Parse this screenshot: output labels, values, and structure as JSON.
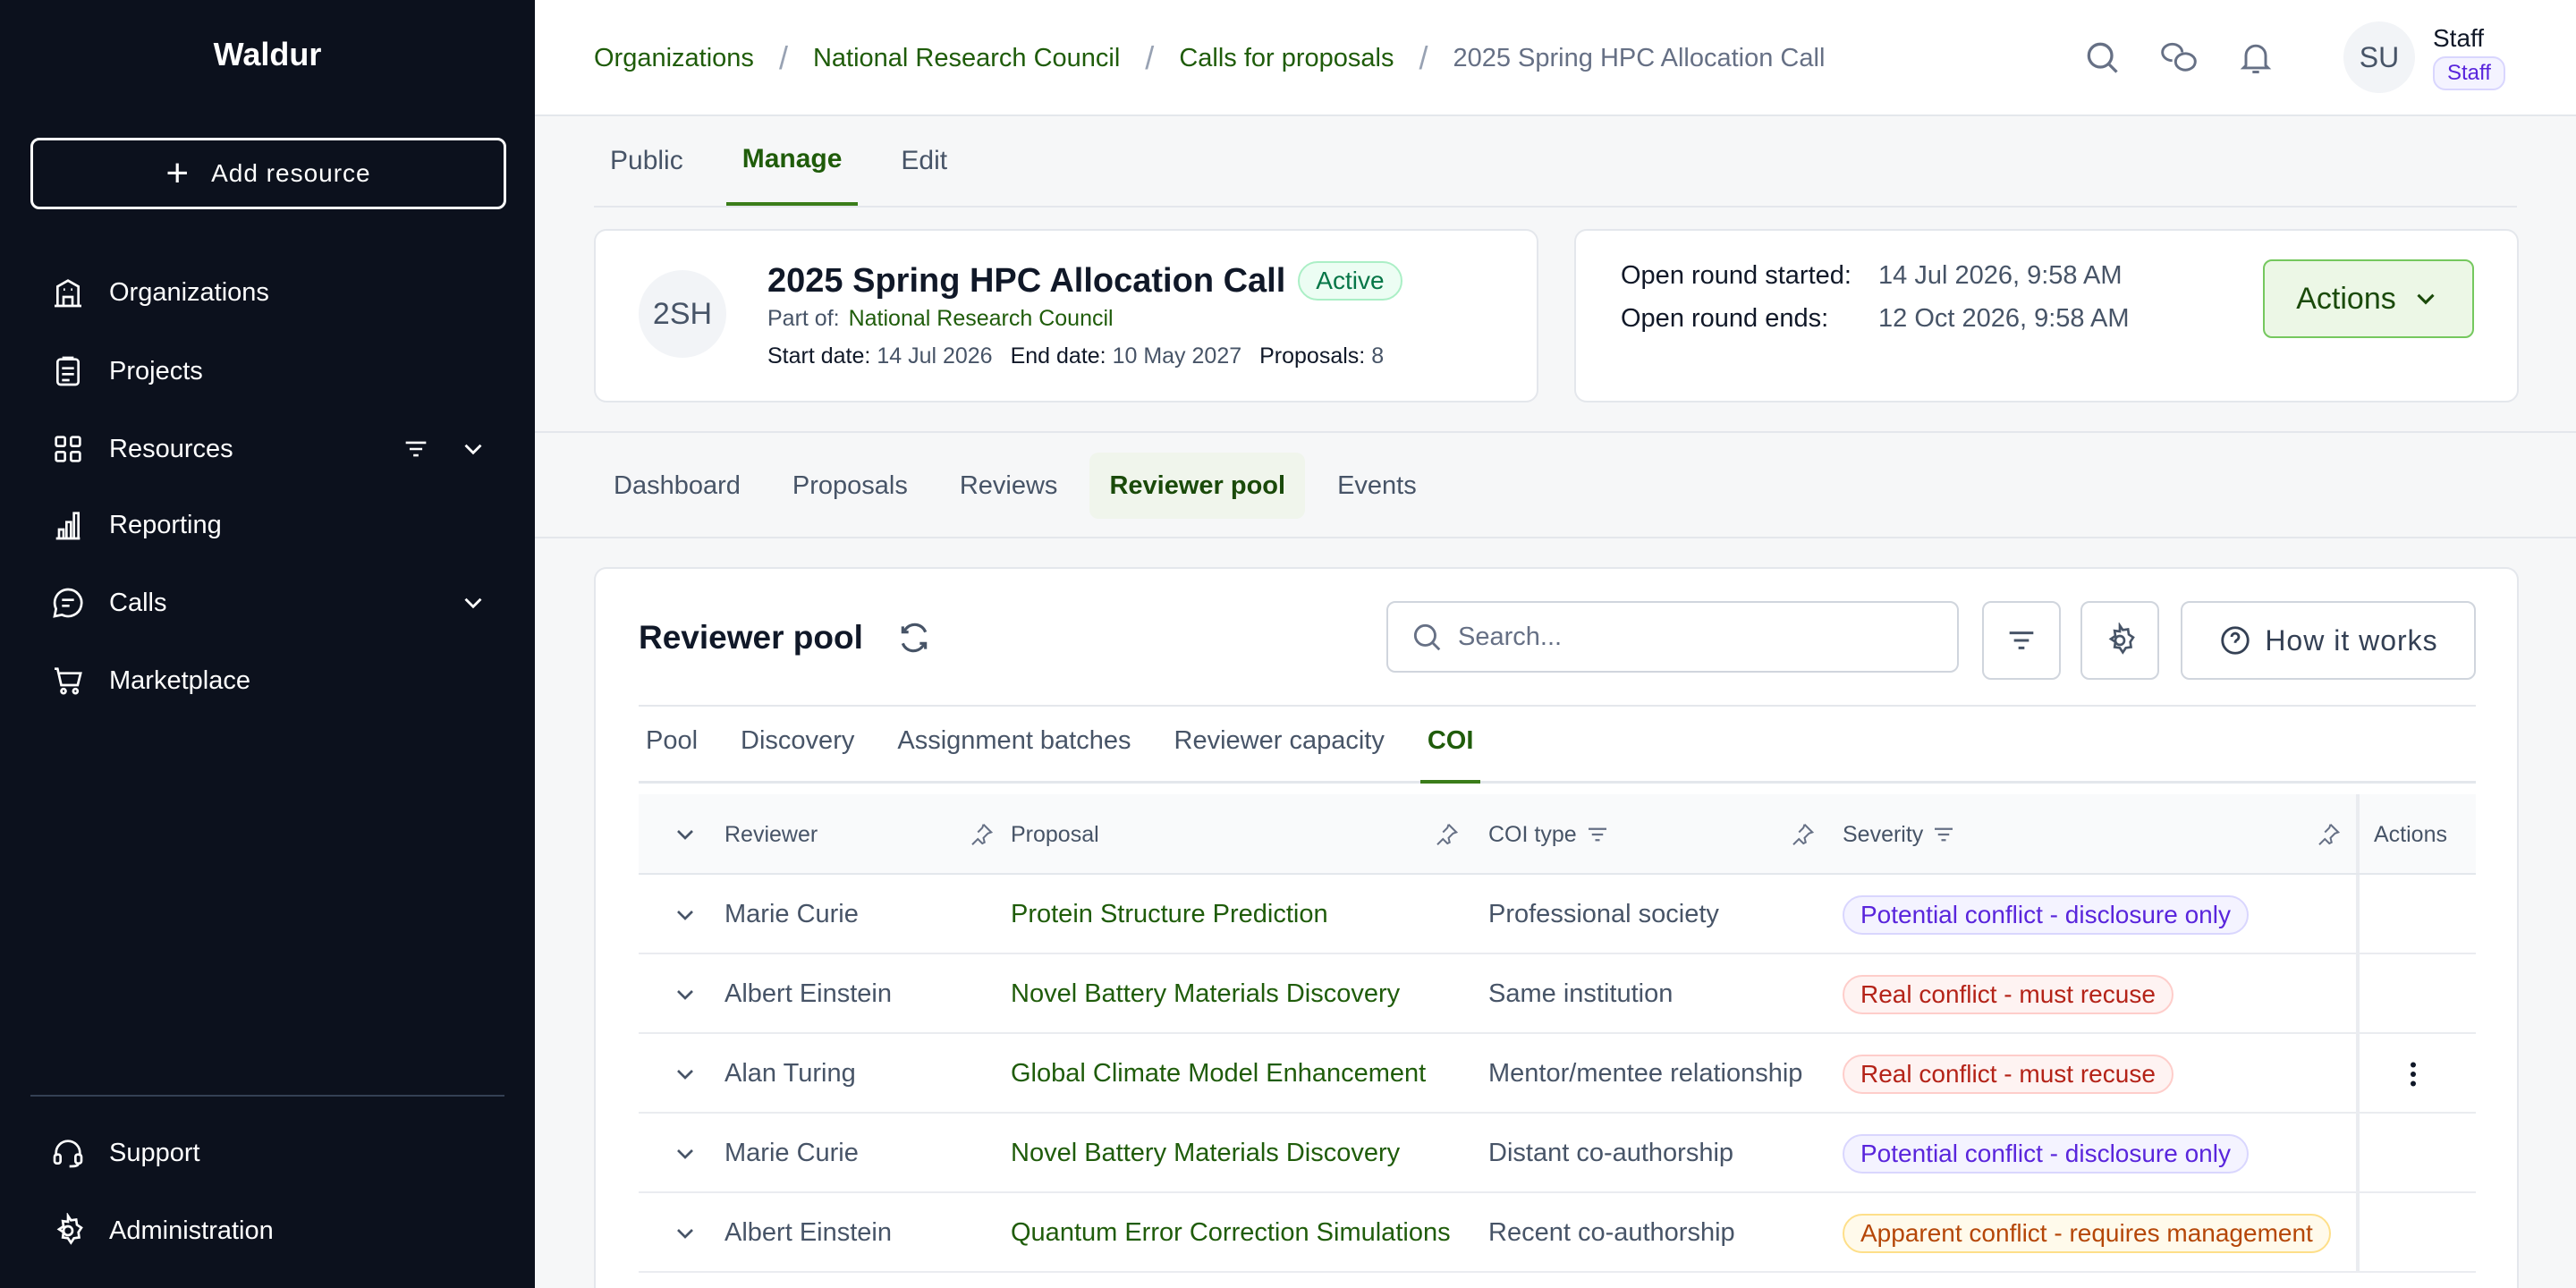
{
  "sidebar": {
    "brand": "Waldur",
    "add_resource": "Add resource",
    "items": [
      {
        "label": "Organizations"
      },
      {
        "label": "Projects"
      },
      {
        "label": "Resources"
      },
      {
        "label": "Reporting"
      },
      {
        "label": "Calls"
      },
      {
        "label": "Marketplace"
      }
    ],
    "bottom_items": [
      {
        "label": "Support"
      },
      {
        "label": "Administration"
      }
    ]
  },
  "breadcrumb": {
    "items": [
      "Organizations",
      "National Research Council",
      "Calls for proposals"
    ],
    "current": "2025 Spring HPC Allocation Call"
  },
  "user": {
    "initials": "SU",
    "name": "Staff",
    "role": "Staff"
  },
  "page_tabs": [
    "Public",
    "Manage",
    "Edit"
  ],
  "call": {
    "avatar": "2SH",
    "title": "2025 Spring HPC Allocation Call",
    "status": "Active",
    "part_of_label": "Part of:",
    "part_of": "National Research Council",
    "start_label": "Start date:",
    "start": "14 Jul 2026",
    "end_label": "End date:",
    "end": "10 May 2027",
    "proposals_label": "Proposals:",
    "proposals": "8"
  },
  "round": {
    "started_label": "Open round started:",
    "started": "14 Jul 2026, 9:58 AM",
    "ends_label": "Open round ends:",
    "ends": "12 Oct 2026, 9:58 AM",
    "actions": "Actions"
  },
  "sub_tabs": [
    "Dashboard",
    "Proposals",
    "Reviews",
    "Reviewer pool",
    "Events"
  ],
  "pool": {
    "title": "Reviewer pool",
    "search_placeholder": "Search...",
    "how_it_works": "How it works",
    "tabs": [
      "Pool",
      "Discovery",
      "Assignment batches",
      "Reviewer capacity",
      "COI"
    ]
  },
  "table": {
    "headers": {
      "reviewer": "Reviewer",
      "proposal": "Proposal",
      "coi_type": "COI type",
      "severity": "Severity",
      "actions": "Actions"
    },
    "rows": [
      {
        "reviewer": "Marie Curie",
        "proposal": "Protein Structure Prediction",
        "coi_type": "Professional society",
        "severity": "Potential conflict - disclosure only",
        "severity_kind": "potential"
      },
      {
        "reviewer": "Albert Einstein",
        "proposal": "Novel Battery Materials Discovery",
        "coi_type": "Same institution",
        "severity": "Real conflict - must recuse",
        "severity_kind": "real"
      },
      {
        "reviewer": "Alan Turing",
        "proposal": "Global Climate Model Enhancement",
        "coi_type": "Mentor/mentee relationship",
        "severity": "Real conflict - must recuse",
        "severity_kind": "real"
      },
      {
        "reviewer": "Marie Curie",
        "proposal": "Novel Battery Materials Discovery",
        "coi_type": "Distant co-authorship",
        "severity": "Potential conflict - disclosure only",
        "severity_kind": "potential"
      },
      {
        "reviewer": "Albert Einstein",
        "proposal": "Quantum Error Correction Simulations",
        "coi_type": "Recent co-authorship",
        "severity": "Apparent conflict - requires management",
        "severity_kind": "apparent"
      }
    ]
  },
  "colors": {
    "sidebar_bg": "#0c111d",
    "accent_green": "#1f5c0a",
    "active_tab_border": "#3b7d1a"
  }
}
